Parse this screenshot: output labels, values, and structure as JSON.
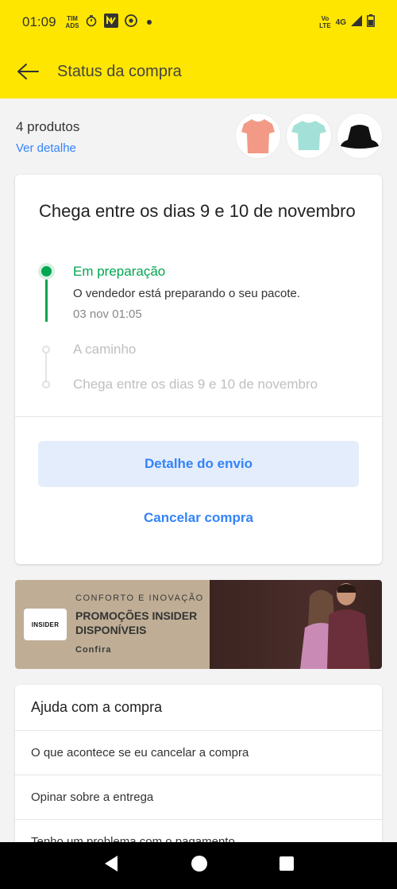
{
  "status_bar": {
    "time": "01:09",
    "carrier_line1": "TIM",
    "carrier_line2": "ADS",
    "network_line1": "Vo",
    "network_line2": "LTE",
    "network_type": "4G"
  },
  "header": {
    "title": "Status da compra"
  },
  "products": {
    "count_label": "4 produtos",
    "detail_link": "Ver detalhe",
    "thumbnails": [
      "salmon-tshirt",
      "mint-tshirt",
      "black-bucket-hat"
    ]
  },
  "status_card": {
    "title": "Chega entre os dias 9 e 10 de novembro",
    "steps": [
      {
        "title": "Em preparação",
        "description": "O vendedor está preparando o seu pacote.",
        "date": "03 nov 01:05",
        "active": true
      },
      {
        "title": "A caminho",
        "active": false
      },
      {
        "title": "Chega entre os dias 9 e 10 de novembro",
        "active": false
      }
    ],
    "primary_button": "Detalhe do envio",
    "secondary_button": "Cancelar compra"
  },
  "banner": {
    "logo_text": "INSIDER",
    "kicker": "CONFORTO E INOVAÇÃO",
    "headline": "PROMOÇÕES INSIDER DISPONÍVEIS",
    "cta": "Confira"
  },
  "help": {
    "title": "Ajuda com a compra",
    "items": [
      "O que acontece se eu cancelar a compra",
      "Opinar sobre a entrega",
      "Tenho um problema com o pagamento"
    ]
  },
  "colors": {
    "brand_yellow": "#ffe600",
    "link_blue": "#3483fa",
    "success_green": "#00a650"
  }
}
